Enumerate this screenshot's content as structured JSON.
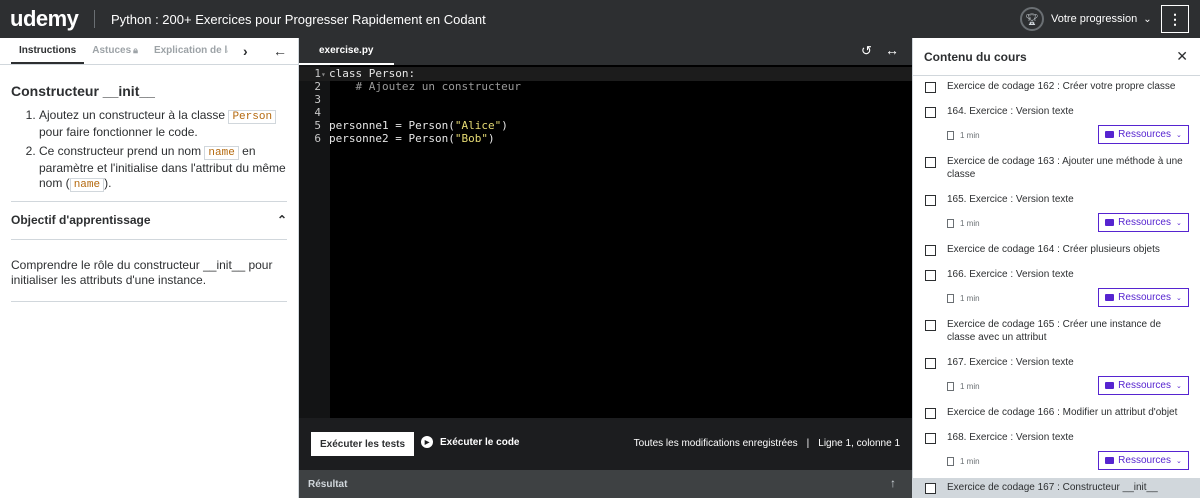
{
  "topbar": {
    "logo": "udemy",
    "course_title": "Python : 200+ Exercices pour Progresser Rapidement en Codant",
    "progress_label": "Votre progression"
  },
  "left": {
    "tabs": [
      "Instructions",
      "Astuces",
      "Explication de la s"
    ],
    "heading": "Constructeur __init__",
    "step1_a": "Ajoutez un constructeur à la classe ",
    "step1_code": "Person",
    "step1_b": " pour faire fonctionner le code.",
    "step2_a": "Ce constructeur prend un nom ",
    "step2_code": "name",
    "step2_b": " en paramètre et l'initialise dans l'attribut du même nom (",
    "step2_code2": "name",
    "step2_c": ").",
    "objective_title": "Objectif d'apprentissage",
    "objective_text": "Comprendre le rôle du constructeur __init__ pour initialiser les attributs d'une instance."
  },
  "editor": {
    "file_tab": "exercise.py",
    "lines": [
      {
        "n": "1",
        "kw": "class Person:",
        "cm": "",
        "pre": "",
        "str": "",
        "post": ""
      },
      {
        "n": "2",
        "kw": "",
        "cm": "    # Ajoutez un constructeur",
        "pre": "",
        "str": "",
        "post": ""
      },
      {
        "n": "3",
        "kw": "",
        "cm": "",
        "pre": "",
        "str": "",
        "post": ""
      },
      {
        "n": "4",
        "kw": "",
        "cm": "",
        "pre": "",
        "str": "",
        "post": ""
      },
      {
        "n": "5",
        "kw": "",
        "cm": "",
        "pre": "personne1 = Person(",
        "str": "\"Alice\"",
        "post": ")"
      },
      {
        "n": "6",
        "kw": "",
        "cm": "",
        "pre": "personne2 = Person(",
        "str": "\"Bob\"",
        "post": ")"
      }
    ],
    "run_tests": "Exécuter les tests",
    "run_code": "Exécuter le code",
    "saved_status": "Toutes les modifications enregistrées",
    "cursor_pos": "Ligne 1, colonne 1",
    "result_label": "Résultat"
  },
  "sidebar": {
    "title": "Contenu du cours",
    "resources_label": "Ressources",
    "duration": "1 min",
    "items": [
      {
        "title": "Exercice de codage 162 : Créer votre propre classe"
      },
      {
        "title": "164. Exercice : Version texte"
      },
      {
        "title": "Exercice de codage 163 : Ajouter une méthode à une classe"
      },
      {
        "title": "165. Exercice : Version texte"
      },
      {
        "title": "Exercice de codage 164 : Créer plusieurs objets"
      },
      {
        "title": "166. Exercice : Version texte"
      },
      {
        "title": "Exercice de codage 165 : Créer une instance de classe avec un attribut"
      },
      {
        "title": "167. Exercice : Version texte"
      },
      {
        "title": "Exercice de codage 166 : Modifier un attribut d'objet"
      },
      {
        "title": "168. Exercice : Version texte"
      },
      {
        "title": "Exercice de codage 167 : Constructeur __init__"
      }
    ]
  }
}
